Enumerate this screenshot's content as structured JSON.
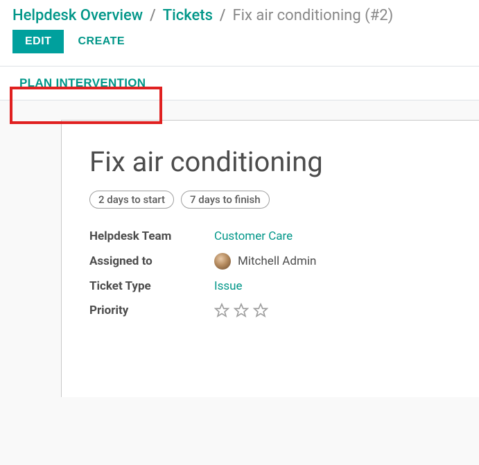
{
  "breadcrumb": {
    "root": "Helpdesk Overview",
    "parent": "Tickets",
    "current": "Fix air conditioning (#2)",
    "sep": "/"
  },
  "actions": {
    "edit": "EDIT",
    "create": "CREATE"
  },
  "statusbar": {
    "plan_intervention": "PLAN INTERVENTION"
  },
  "record": {
    "title": "Fix air conditioning",
    "tags": [
      "2 days to start",
      "7 days to finish"
    ]
  },
  "fields": {
    "helpdesk_team": {
      "label": "Helpdesk Team",
      "value": "Customer Care"
    },
    "assigned_to": {
      "label": "Assigned to",
      "value": "Mitchell Admin"
    },
    "ticket_type": {
      "label": "Ticket Type",
      "value": "Issue"
    },
    "priority": {
      "label": "Priority",
      "stars": 3,
      "filled": 0
    }
  },
  "colors": {
    "accent": "#009688",
    "highlight": "#e02020"
  }
}
